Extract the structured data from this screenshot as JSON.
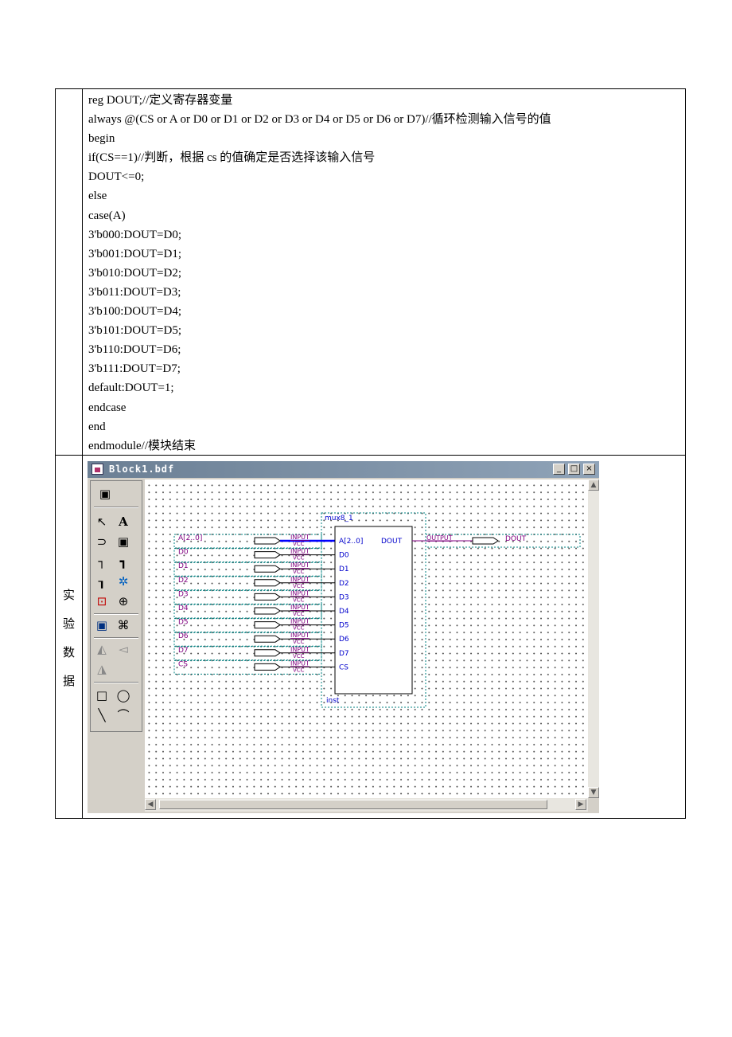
{
  "code_lines": [
    "reg DOUT;//定义寄存器变量",
    "always @(CS or A or D0 or D1 or D2 or D3 or D4 or D5 or D6 or D7)//循环检测输入信号的值",
    "begin",
    "if(CS==1)//判断，根据 cs 的值确定是否选择该输入信号",
    "DOUT<=0;",
    "else",
    "case(A)",
    "3'b000:DOUT=D0;",
    "3'b001:DOUT=D1;",
    "3'b010:DOUT=D2;",
    "3'b011:DOUT=D3;",
    "3'b100:DOUT=D4;",
    "3'b101:DOUT=D5;",
    "3'b110:DOUT=D6;",
    "3'b111:DOUT=D7;",
    "default:DOUT=1;",
    "endcase",
    "end",
    "endmodule//模块结束"
  ],
  "row_label": [
    "实",
    "验",
    "数",
    "据"
  ],
  "window": {
    "title": "Block1.bdf",
    "minimize": "_",
    "maximize": "□",
    "close": "×"
  },
  "schematic": {
    "instance_name": "mux8_1",
    "instance_label": "inst",
    "input_pin_type": "INPUT",
    "input_pin_default": "VCC",
    "output_pin_type": "OUTPUT",
    "inputs": [
      "A[2..0]",
      "D0",
      "D1",
      "D2",
      "D3",
      "D4",
      "D5",
      "D6",
      "D7",
      "CS"
    ],
    "ports_in": [
      "A[2..0]",
      "D0",
      "D1",
      "D2",
      "D3",
      "D4",
      "D5",
      "D6",
      "D7",
      "CS"
    ],
    "port_out": "DOUT",
    "output_name": "DOUT"
  },
  "tools": [
    "selection-tool",
    "text-tool",
    "symbol-tool",
    "block-tool",
    "orthogonal-node-tool",
    "orthogonal-bus-tool",
    "orthogonal-conduit-tool",
    "use-rubberbanding",
    "partial-line-selection",
    "zoom-tool",
    "full-screen",
    "find",
    "flip-horizontal",
    "flip-vertical",
    "rotate",
    "rectangle-tool",
    "oval-tool",
    "line-tool",
    "arc-tool"
  ],
  "colors": {
    "pin_name": "#800080",
    "port_text": "#0000cc",
    "wire": "#000000",
    "bus": "#0000ff",
    "output_wire": "#800080",
    "group_box": "#008080"
  }
}
